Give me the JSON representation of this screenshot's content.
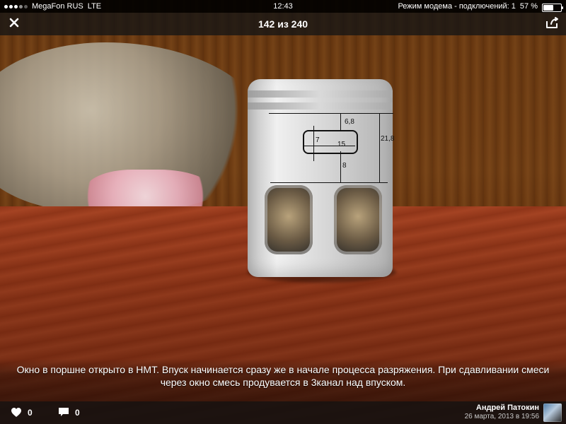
{
  "statusbar": {
    "carrier": "MegaFon RUS",
    "network": "LTE",
    "time": "12:43",
    "hotspot": "Режим модема - подключений: 1",
    "battery_percent": "57 %",
    "battery_level": 0.57
  },
  "header": {
    "counter": "142 из 240",
    "icons": {
      "close": "close-icon",
      "share": "share-icon"
    }
  },
  "photo": {
    "dimensions": {
      "d1": "6,8",
      "d2": "7",
      "d3": "15",
      "d4": "8",
      "d5": "21,8"
    }
  },
  "caption": {
    "text": "Окно в поршне открыто в НМТ. Впуск начинается сразу же в начале процесса разряжения. При сдавливании смеси через окно смесь продувается в 3канал над впуском."
  },
  "footer": {
    "likes_count": "0",
    "comments_count": "0",
    "author_name": "Андрей Патокин",
    "author_date": "26 марта, 2013 в 19:56",
    "icons": {
      "like": "heart-icon",
      "comment": "comment-icon"
    }
  }
}
